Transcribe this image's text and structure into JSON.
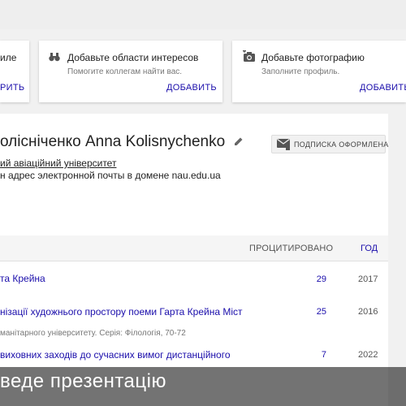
{
  "cards": [
    {
      "title": "иле",
      "subtitle": "",
      "action": "РИТЬ"
    },
    {
      "title": "Добавьте области интересов",
      "subtitle": "Помогите коллегам найти вас.",
      "action": "ДОБАВИТЬ",
      "icon": "binoculars-icon"
    },
    {
      "title": "Добавьте фотографию",
      "subtitle": "Заполните профиль.",
      "action": "ДОБАВИТЬ",
      "icon": "camera-icon"
    }
  ],
  "profile": {
    "name": "олісніченко Anna Kolisnychenko",
    "affiliation": "ий авіаційний університет",
    "email": "н адрес электронной почты в домене nau.edu.ua",
    "follow_label": "ПОДПИСКА ОФОРМЛЕНА"
  },
  "table": {
    "cited_header": "ПРОЦИТИРОВАНО",
    "year_header": "ГОД",
    "rows": [
      {
        "title": "та Крейна",
        "sub": "",
        "cited": "29",
        "year": "2017"
      },
      {
        "title": "нізації художнього простору поеми Гарта Крейна Міст",
        "sub": "манітарного університету. Серія: Філологія, 70-72",
        "cited": "25",
        "year": "2016"
      },
      {
        "title": "виховних заходів до сучасних вимог дистанційного",
        "sub": "",
        "cited": "7",
        "year": "2022"
      }
    ]
  },
  "caption": "веде презентацію"
}
